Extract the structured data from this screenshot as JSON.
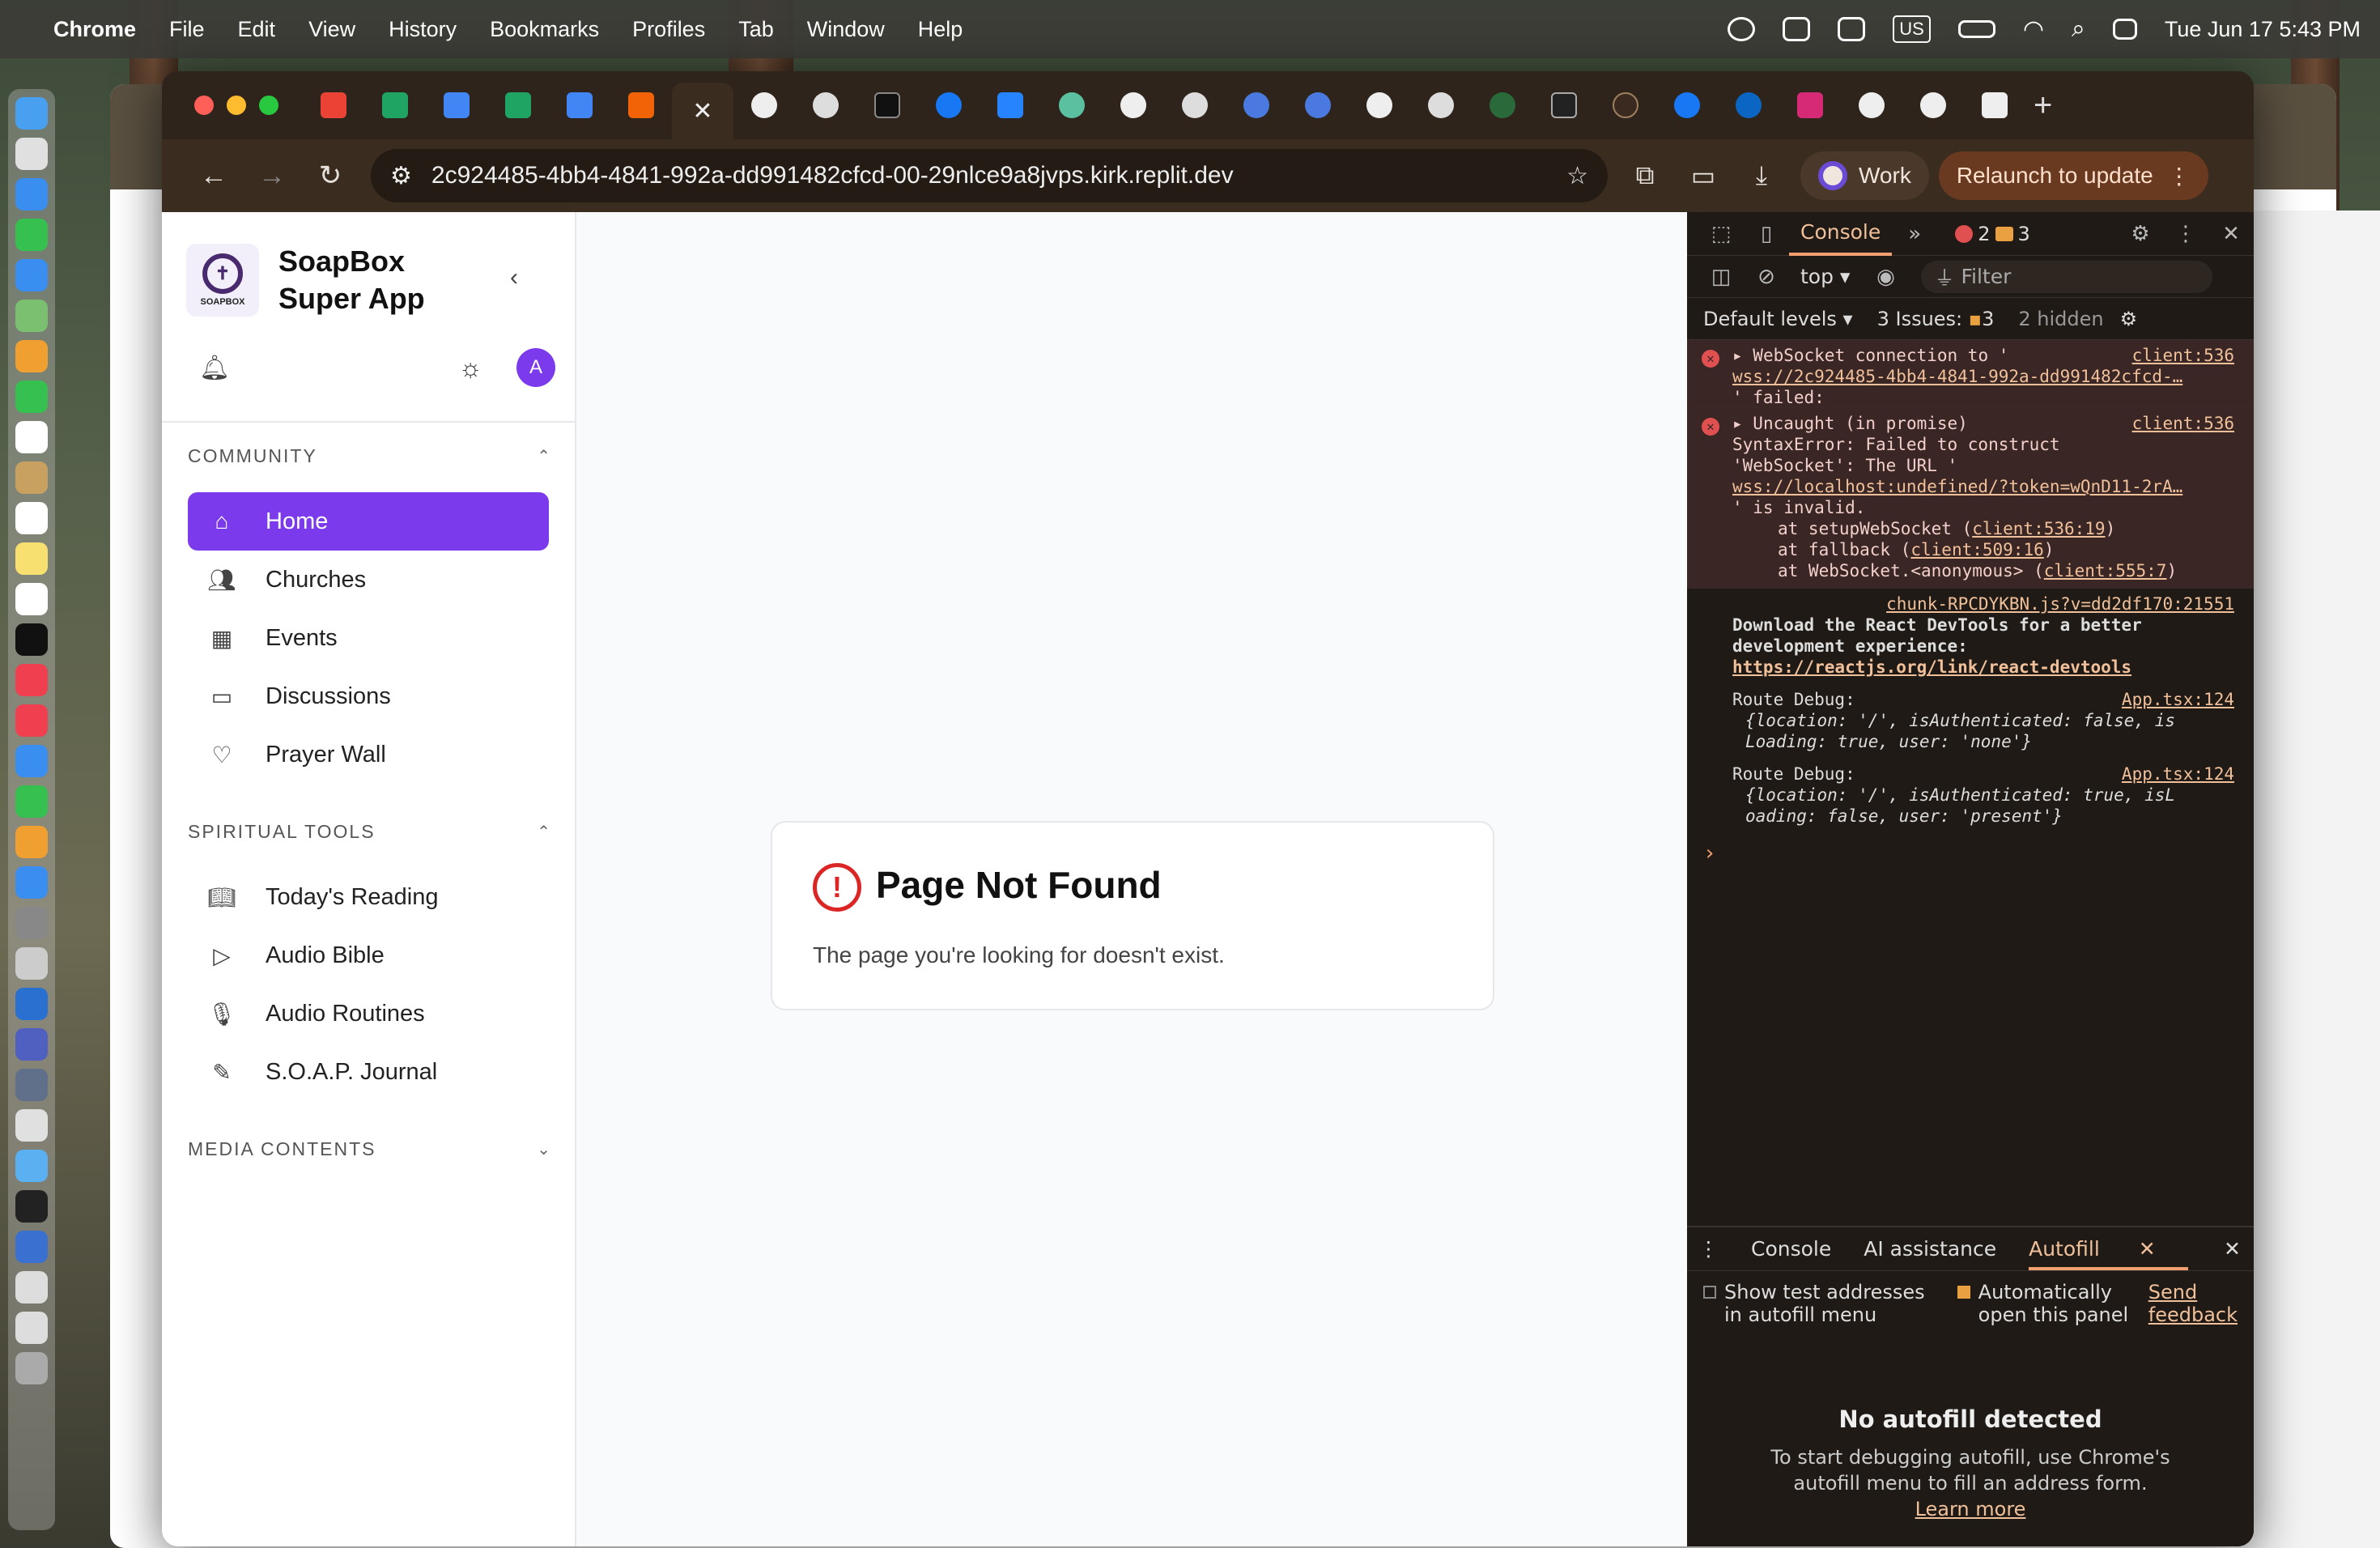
{
  "menubar": {
    "app": "Chrome",
    "items": [
      "File",
      "Edit",
      "View",
      "History",
      "Bookmarks",
      "Profiles",
      "Tab",
      "Window",
      "Help"
    ],
    "keyboard": "US",
    "clock": "Tue Jun 17  5:43 PM"
  },
  "toolbar": {
    "url": "2c924485-4bb4-4841-992a-dd991482cfcd-00-29nlce9a8jvps.kirk.replit.dev",
    "profile": "Work",
    "relaunch": "Relaunch to update"
  },
  "sidebar": {
    "logo_text": "SOAPBOX",
    "title_line1": "SoapBox",
    "title_line2": "Super App",
    "avatar": "A",
    "sections": {
      "community": "COMMUNITY",
      "spiritual": "SPIRITUAL TOOLS",
      "media": "MEDIA CONTENTS"
    },
    "community_items": [
      "Home",
      "Churches",
      "Events",
      "Discussions",
      "Prayer Wall"
    ],
    "spiritual_items": [
      "Today's Reading",
      "Audio Bible",
      "Audio Routines",
      "S.O.A.P. Journal"
    ]
  },
  "not_found": {
    "title": "Page Not Found",
    "message": "The page you're looking for doesn't exist."
  },
  "devtools": {
    "tab": "Console",
    "errors": "2",
    "warnings": "3",
    "context": "top",
    "filter": "Filter",
    "levels": "Default levels",
    "issues": "3 Issues:",
    "issues_count": "3",
    "hidden": "2 hidden",
    "messages": {
      "ws_line1": "WebSocket connection to '",
      "ws_link": "wss://2c924485-4bb4-4841-992a-dd991482cfcd-…",
      "ws_line3": "' failed:",
      "ws_src": "client:536",
      "unc_line1": "Uncaught (in promise)",
      "unc_line2": "SyntaxError: Failed to construct",
      "unc_line3": "'WebSocket': The URL '",
      "unc_link": "wss://localhost:undefined/?token=wQnD11-2rA…",
      "unc_line5": "' is invalid.",
      "unc_at1": "at setupWebSocket (",
      "unc_at1_link": "client:536:19",
      "unc_at2": "at fallback (",
      "unc_at2_link": "client:509:16",
      "unc_at3": "at WebSocket.<anonymous> (",
      "unc_at3_link": "client:555:7",
      "unc_src": "client:536",
      "react_src": "chunk-RPCDYKBN.js?v=dd2df170:21551",
      "react_line1": "Download the React DevTools for a better",
      "react_line2": "development experience:",
      "react_link": "https://reactjs.org/link/react-devtools",
      "route_label": "Route Debug:",
      "route_src": "App.tsx:124",
      "route1_a": "{location: '/', isAuthenticated: false, is",
      "route1_b": "Loading: true, user: 'none'}",
      "route2_a": "{location: '/', isAuthenticated: true, isL",
      "route2_b": "oading: false, user: 'present'}"
    },
    "drawer": {
      "tabs": [
        "Console",
        "AI assistance",
        "Autofill"
      ],
      "show_test_1": "Show test addresses",
      "show_test_2": "in autofill menu",
      "auto_open_1": "Automatically",
      "auto_open_2": "open this panel",
      "feedback_1": "Send",
      "feedback_2": "feedback",
      "empty_title": "No autofill detected",
      "empty_desc_1": "To start debugging autofill, use Chrome's",
      "empty_desc_2": "autofill menu to fill an address form.",
      "learn_more": "Learn more"
    }
  },
  "colors": {
    "accent": "#7c3aed",
    "error": "#dc2626",
    "devtools_accent": "#f0a070"
  }
}
